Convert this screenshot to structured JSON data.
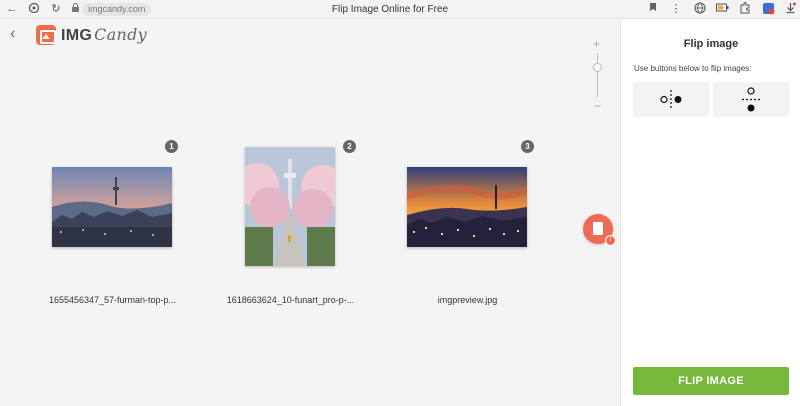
{
  "browser": {
    "url": "imgcandy.com",
    "title": "Flip Image Online for Free"
  },
  "brand": {
    "name": "IMG",
    "name_script": "Candy",
    "accent": "#f26a4b"
  },
  "images": [
    {
      "index": "1",
      "filename": "1655456347_57-furman-top-p..."
    },
    {
      "index": "2",
      "filename": "1618663624_10-funart_pro-p-..."
    },
    {
      "index": "3",
      "filename": "imgpreview.jpg"
    }
  ],
  "zoom": {
    "plus": "+",
    "minus": "−"
  },
  "panel": {
    "title": "Flip image",
    "hint": "Use buttons below to flip images:",
    "options": [
      {
        "name": "flip-horizontal",
        "icon": "flip-horizontal-icon"
      },
      {
        "name": "flip-vertical",
        "icon": "flip-vertical-icon"
      }
    ],
    "action_label": "FLIP IMAGE",
    "action_color": "#76b93a"
  }
}
